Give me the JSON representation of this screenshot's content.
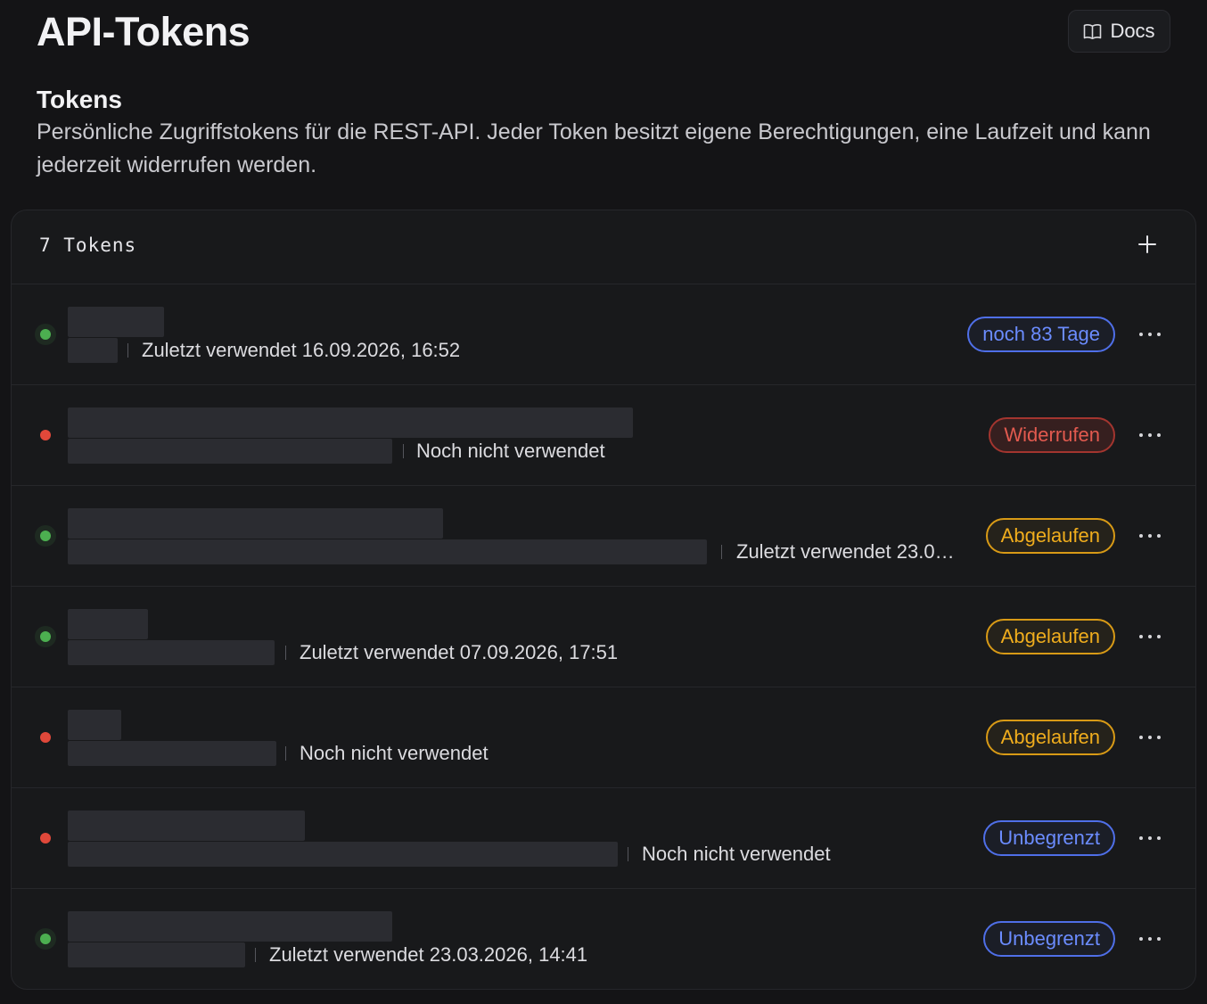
{
  "header": {
    "title": "API-Tokens",
    "docs_label": "Docs"
  },
  "section": {
    "title": "Tokens",
    "description": "Persönliche Zugriffstokens für die REST-API. Jeder Token besitzt eigene Berechtigungen, eine Laufzeit und kann jederzeit widerrufen werden."
  },
  "card": {
    "count_label": "7  Tokens"
  },
  "tokens": [
    {
      "status": "active",
      "last_used": "Zuletzt verwendet 16.09.2026, 16:52",
      "badge": "noch 83 Tage",
      "badge_color": "blue"
    },
    {
      "status": "inactive",
      "last_used": "Noch nicht verwendet",
      "badge": "Widerrufen",
      "badge_color": "red"
    },
    {
      "status": "active",
      "last_used": "Zuletzt verwendet 23.0…",
      "badge": "Abgelaufen",
      "badge_color": "amber"
    },
    {
      "status": "active",
      "last_used": "Zuletzt verwendet 07.09.2026, 17:51",
      "badge": "Abgelaufen",
      "badge_color": "amber"
    },
    {
      "status": "inactive",
      "last_used": "Noch nicht verwendet",
      "badge": "Abgelaufen",
      "badge_color": "amber"
    },
    {
      "status": "inactive",
      "last_used": "Noch nicht verwendet",
      "badge": "Unbegrenzt",
      "badge_color": "blue"
    },
    {
      "status": "active",
      "last_used": "Zuletzt verwendet 23.03.2026, 14:41",
      "badge": "Unbegrenzt",
      "badge_color": "blue"
    }
  ],
  "icons": {
    "docs": "book-open-icon",
    "add": "plus-icon",
    "more": "more-horizontal-icon",
    "status": "status-dot-icon"
  },
  "colors": {
    "active": "#4caf50",
    "inactive": "#e0483a",
    "blue": "#6b8cff",
    "red": "#e25a4f",
    "amber": "#f0ad1d"
  }
}
